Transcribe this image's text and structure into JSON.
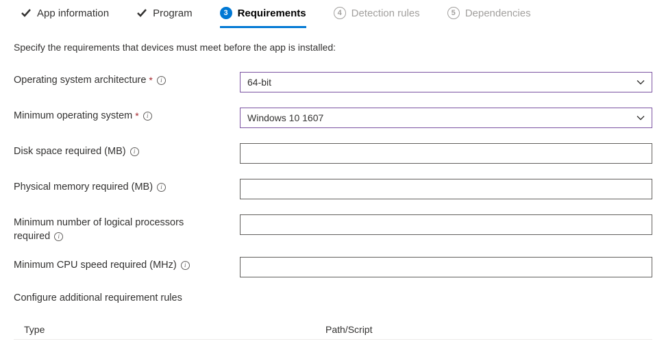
{
  "tabs": {
    "app_info": "App information",
    "program": "Program",
    "requirements": {
      "num": "3",
      "label": "Requirements"
    },
    "detection": {
      "num": "4",
      "label": "Detection rules"
    },
    "dependencies": {
      "num": "5",
      "label": "Dependencies"
    }
  },
  "intro": "Specify the requirements that devices must meet before the app is installed:",
  "fields": {
    "os_arch": {
      "label": "Operating system architecture",
      "value": "64-bit"
    },
    "min_os": {
      "label": "Minimum operating system",
      "value": "Windows 10 1607"
    },
    "disk": {
      "label": "Disk space required (MB)",
      "value": ""
    },
    "memory": {
      "label": "Physical memory required (MB)",
      "value": ""
    },
    "processors": {
      "label_line1": "Minimum number of logical processors",
      "label_line2": "required",
      "value": ""
    },
    "cpu_speed": {
      "label": "Minimum CPU speed required (MHz)",
      "value": ""
    }
  },
  "additional_rules_title": "Configure additional requirement rules",
  "table": {
    "col_type": "Type",
    "col_path": "Path/Script"
  }
}
